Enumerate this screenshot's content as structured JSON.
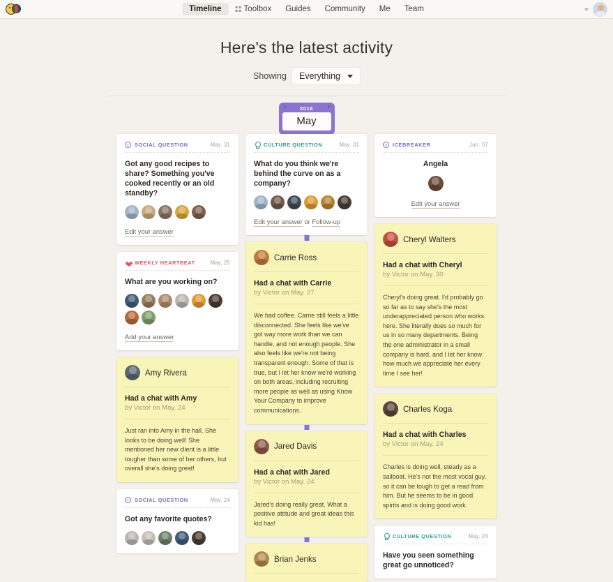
{
  "nav": {
    "logo_icon": "smiley-logo-icon",
    "links": [
      {
        "label": "Timeline",
        "active": true,
        "icon": null
      },
      {
        "label": "Toolbox",
        "active": false,
        "icon": "grid-icon"
      },
      {
        "label": "Guides",
        "active": false,
        "icon": null
      },
      {
        "label": "Community",
        "active": false,
        "icon": null
      },
      {
        "label": "Me",
        "active": false,
        "icon": null
      },
      {
        "label": "Team",
        "active": false,
        "icon": null
      }
    ],
    "account_caret_icon": "chevron-down-icon",
    "account_avatar_icon": "user-avatar"
  },
  "header": {
    "title": "Here's the latest activity",
    "showing_label": "Showing",
    "filter_value": "Everything",
    "filter_caret_icon": "chevron-down-icon"
  },
  "timeline": {
    "year": "2018",
    "month": "May"
  },
  "columns": [
    {
      "cards": [
        {
          "type": "question",
          "kind": "SOCIAL QUESTION",
          "kind_class": "social",
          "icon": "clock-icon",
          "date": "May. 31",
          "question": "Got any good recipes to share? Something you've cooked recently or an old standby?",
          "avatars": [
            "#9fb4c9",
            "#c8a87e",
            "#8a7364",
            "#d8a43c",
            "#7d5f4e"
          ],
          "link": "Edit your answer",
          "link2": null,
          "link_joiner": null
        },
        {
          "type": "question",
          "kind": "WEEKLY HEARTBEAT",
          "kind_class": "heartbeat",
          "icon": "heart-icon",
          "date": "May. 25",
          "question": "What are you working on?",
          "avatars": [
            "#3f5b78",
            "#9a7c5c",
            "#b08a6a",
            "#b9b6b1",
            "#e09a33",
            "#4a3c33",
            "#b8693a",
            "#7fa06a"
          ],
          "link": "Add your answer",
          "link2": null,
          "link_joiner": null
        },
        {
          "type": "note",
          "person": "Amy Rivera",
          "avatar_color": "#5b6670",
          "title": "Had a chat with Amy",
          "by": "by Victor on May. 24",
          "body": "Just ran into Amy in the hall. She looks to be doing well! She mentioned her new client is a little tougher than some of her others, but overall she's doing great!"
        },
        {
          "type": "question",
          "kind": "SOCIAL QUESTION",
          "kind_class": "social",
          "icon": "clock-icon",
          "date": "May. 24",
          "question": "Got any favorite quotes?",
          "avatars": [
            "#b9b6b1",
            "#c4bfb6",
            "#6d7f6a",
            "#3f5b78",
            "#4a3c33"
          ],
          "link": null,
          "link2": null,
          "link_joiner": null
        }
      ]
    },
    {
      "cards": [
        {
          "type": "question",
          "kind": "CULTURE QUESTION",
          "kind_class": "culture",
          "icon": "lightbulb-icon",
          "date": "May. 31",
          "question": "What do you think we're behind the curve on as a company?",
          "avatars": [
            "#9fb4c9",
            "#6f5a4a",
            "#3e4a55",
            "#e09a33",
            "#b5832f",
            "#4a3c33"
          ],
          "link": "Edit your answer",
          "link_joiner": "or",
          "link2": "Follow-up"
        },
        {
          "type": "note",
          "person": "Carrie Ross",
          "avatar_color": "#c07b3a",
          "title": "Had a chat with Carrie",
          "by": "by Victor on May. 27",
          "body": "We had coffee. Carrie still feels a little disconnected. She feels like we've got way more work than we can handle, and not enough people. She also feels like we're not being transparent enough. Some of that is true, but I let her know we're working on both areas, including recruiting more people as well as using Know Your Company to improve communications."
        },
        {
          "type": "note",
          "person": "Jared Davis",
          "avatar_color": "#8d5a4a",
          "title": "Had a chat with Jared",
          "by": "by Victor on May. 24",
          "body": "Jared's doing really great. What a positive attitude and great ideas this kid has!"
        },
        {
          "type": "note",
          "person": "Brian Jenks",
          "avatar_color": "#b08a4a",
          "title": "",
          "by": "",
          "body": ""
        }
      ]
    },
    {
      "cards": [
        {
          "type": "icebreaker",
          "kind": "ICEBREAKER",
          "kind_class": "icebreaker",
          "icon": "clock-icon",
          "date": "Jun. 07",
          "question": "Angela",
          "avatars": [
            "#6b4a38"
          ],
          "link": "Edit your answer"
        },
        {
          "type": "note",
          "person": "Cheryl Walters",
          "avatar_color": "#c0503c",
          "title": "Had a chat with Cheryl",
          "by": "by Victor on May. 30",
          "body": "Cheryl's doing great. I'd probably go so far as to say she's the most underappreciated person who works here. She literally does so much for us in so many departments. Being the one administrator in a small company is hard, and I let her know how much we appreciate her every time I see her!"
        },
        {
          "type": "note",
          "person": "Charles Koga",
          "avatar_color": "#5a453a",
          "title": "Had a chat with Charles",
          "by": "by Victor on May. 24",
          "body": "Charles is doing well, steady as a sailboat. He's not the most vocal guy, so it can be tough to get a read from him. But he seems to be in good spirits and is doing good work."
        },
        {
          "type": "question",
          "kind": "CULTURE QUESTION",
          "kind_class": "culture",
          "icon": "lightbulb-icon",
          "date": "May. 24",
          "question": "Have you seen something great go unnoticed?",
          "avatars": [],
          "link": null
        }
      ]
    }
  ],
  "colors": {
    "page_bg": "#f4f1ed",
    "accent_purple": "#8b74d0",
    "note_yellow": "#f9f5b9",
    "culture_teal": "#2f9e8f",
    "heartbeat_red": "#e2566a"
  }
}
